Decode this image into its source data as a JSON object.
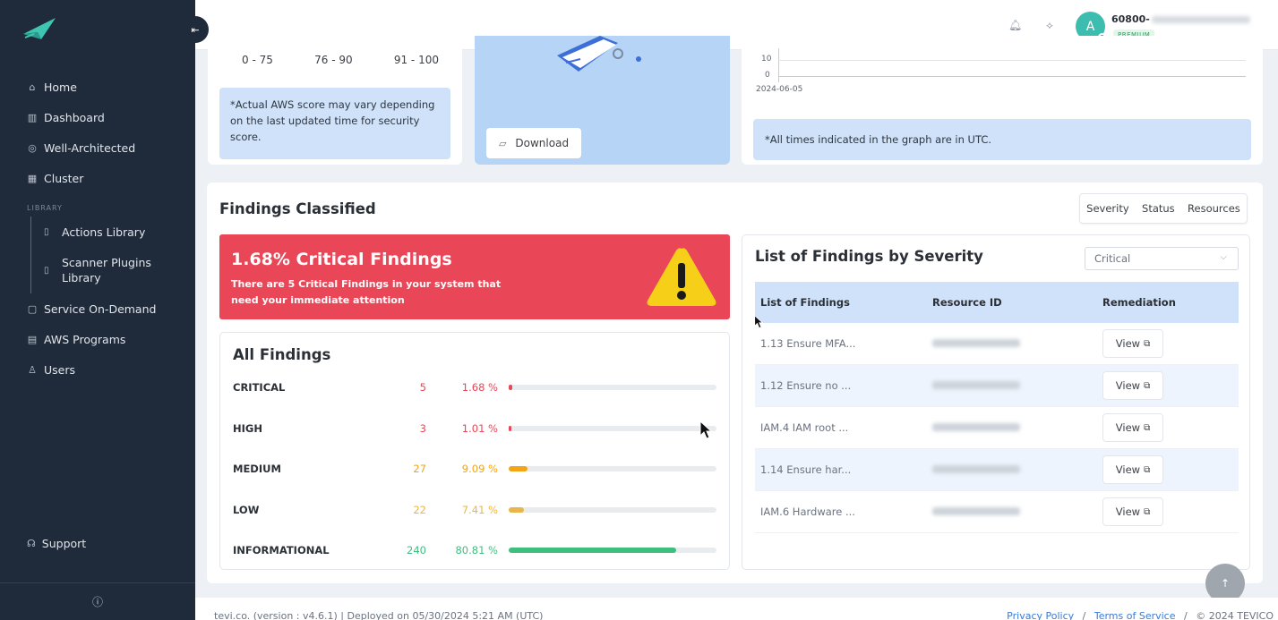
{
  "sidebar": {
    "collapse_icon": "⇤",
    "items": [
      {
        "icon": "home-icon",
        "glyph": "⌂",
        "label": "Home"
      },
      {
        "icon": "dashboard-icon",
        "glyph": "▥",
        "label": "Dashboard"
      },
      {
        "icon": "target-icon",
        "glyph": "◎",
        "label": "Well-Architected"
      },
      {
        "icon": "cluster-icon",
        "glyph": "▦",
        "label": "Cluster"
      }
    ],
    "library_label": "LIBRARY",
    "library_items": [
      {
        "icon": "book-icon",
        "glyph": "▯",
        "label": "Actions Library"
      },
      {
        "icon": "book-icon",
        "glyph": "▯",
        "label": "Scanner Plugins Library"
      }
    ],
    "items2": [
      {
        "icon": "bag-icon",
        "glyph": "▢",
        "label": "Service On-Demand"
      },
      {
        "icon": "programs-icon",
        "glyph": "▤",
        "label": "AWS Programs"
      },
      {
        "icon": "users-icon",
        "glyph": "♙",
        "label": "Users"
      }
    ],
    "support_label": "Support",
    "info_icon": "ⓘ"
  },
  "header": {
    "account_prefix": "60800-",
    "plan_badge": "PREMIUM",
    "avatar_initial": "A"
  },
  "score_card": {
    "ranges": [
      "0 - 75",
      "76 - 90",
      "91 - 100"
    ],
    "note": "*Actual AWS score may vary depending on the last updated time for security score."
  },
  "report_card": {
    "download_label": "Download"
  },
  "graph_card": {
    "y_ticks": [
      "10",
      "0"
    ],
    "x_tick": "2024-06-05",
    "note": "*All times indicated in the graph are in UTC."
  },
  "findings": {
    "title": "Findings Classified",
    "tabs": [
      "Severity",
      "Status",
      "Resources"
    ],
    "critical_banner": {
      "title": "1.68% Critical Findings",
      "subtitle": "There are 5 Critical Findings in your system that need your immediate attention"
    },
    "all_title": "All Findings",
    "rows": [
      {
        "label": "CRITICAL",
        "count": "5",
        "pct": "1.68 %",
        "frac": 0.0168,
        "color": "#e94657"
      },
      {
        "label": "HIGH",
        "count": "3",
        "pct": "1.01 %",
        "frac": 0.0101,
        "color": "#e94657"
      },
      {
        "label": "MEDIUM",
        "count": "27",
        "pct": "9.09 %",
        "frac": 0.0909,
        "color": "#f2a516"
      },
      {
        "label": "LOW",
        "count": "22",
        "pct": "7.41 %",
        "frac": 0.0741,
        "color": "#e8b64a"
      },
      {
        "label": "INFORMATIONAL",
        "count": "240",
        "pct": "80.81 %",
        "frac": 0.8081,
        "color": "#3fbf7f"
      }
    ],
    "list_title": "List of Findings by Severity",
    "severity_select": "Critical",
    "columns": [
      "List of Findings",
      "Resource ID",
      "Remediation"
    ],
    "list": [
      {
        "finding": "1.13 Ensure MFA..."
      },
      {
        "finding": "1.12 Ensure no ..."
      },
      {
        "finding": "IAM.4 IAM root ..."
      },
      {
        "finding": "1.14 Ensure har..."
      },
      {
        "finding": "IAM.6 Hardware ..."
      }
    ],
    "view_label": "View"
  },
  "footer": {
    "left": "tevi.co. (version : v4.6.1) | Deployed on 05/30/2024 5:21 AM (UTC)",
    "privacy": "Privacy Policy",
    "sep": "/",
    "terms": "Terms of Service",
    "copyright": "© 2024 TEVICO"
  }
}
